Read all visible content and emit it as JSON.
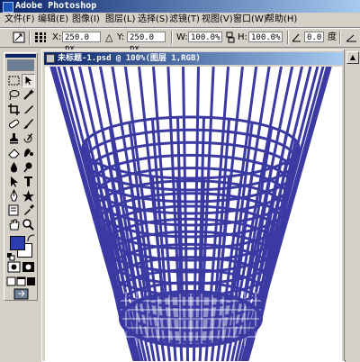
{
  "window": {
    "title": "Adobe Photoshop"
  },
  "menu": [
    "文件(F)",
    "编辑(E)",
    "图像(I)",
    "图层(L)",
    "选择(S)",
    "滤镜(T)",
    "视图(V)",
    "窗口(W)",
    "帮助(H)"
  ],
  "options": {
    "x_label": "X:",
    "x_value": "250.0 px",
    "y_label": "Y:",
    "y_value": "250.0 px",
    "w_label": "W:",
    "w_value": "100.0%",
    "h_label": "H:",
    "h_value": "100.0%",
    "angle_value": "0.0",
    "angle_unit": "度"
  },
  "document": {
    "title": "未标题-1.psd @ 100%(图层 1,RGB)"
  },
  "colors": {
    "basket": "#3b3aa3",
    "foreground": "#2b3bb0",
    "background": "#ffffff",
    "title_bar": "#0a246a"
  },
  "icons": [
    "reference-point-icon",
    "link-icon",
    "angle-icon",
    "skew-icon",
    "move-icon",
    "marquee-icon",
    "lasso-icon",
    "magic-wand-icon",
    "crop-icon",
    "slice-icon",
    "healing-brush-icon",
    "brush-icon",
    "clone-stamp-icon",
    "history-brush-icon",
    "eraser-icon",
    "gradient-icon",
    "blur-icon",
    "dodge-icon",
    "path-select-icon",
    "type-icon",
    "pen-icon",
    "shape-icon",
    "notes-icon",
    "eyedropper-icon",
    "hand-icon",
    "zoom-icon",
    "quick-mask-icon",
    "screen-mode-icon",
    "imageready-icon"
  ]
}
